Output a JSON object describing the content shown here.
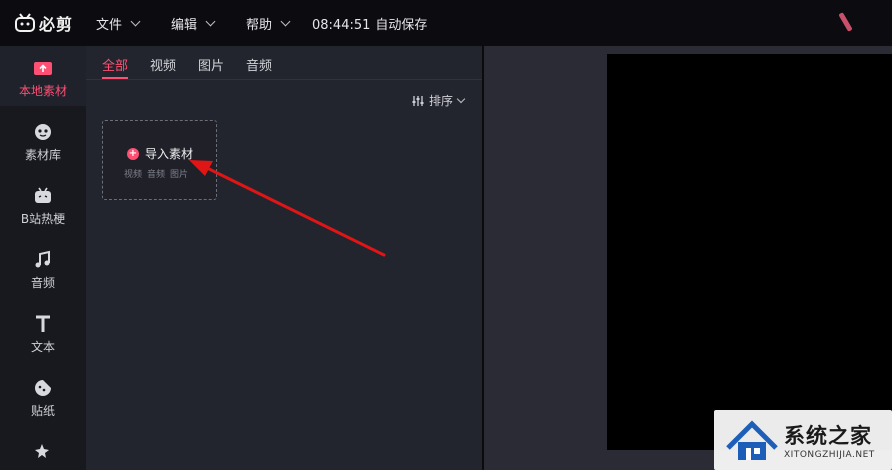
{
  "app": {
    "logo_text": "必剪",
    "menus": [
      {
        "label": "文件"
      },
      {
        "label": "编辑"
      },
      {
        "label": "帮助"
      }
    ],
    "autosave_time": "08:44:51",
    "autosave_label": "自动保存"
  },
  "sidebar": {
    "items": [
      {
        "label": "本地素材",
        "icon": "upload-folder-icon",
        "active": true
      },
      {
        "label": "素材库",
        "icon": "sticker-face-icon"
      },
      {
        "label": "B站热梗",
        "icon": "bilibili-tv-icon"
      },
      {
        "label": "音频",
        "icon": "music-note-icon"
      },
      {
        "label": "文本",
        "icon": "text-t-icon"
      },
      {
        "label": "贴纸",
        "icon": "sticker-icon"
      }
    ]
  },
  "media": {
    "tabs": [
      {
        "label": "全部",
        "active": true
      },
      {
        "label": "视频"
      },
      {
        "label": "图片"
      },
      {
        "label": "音频"
      }
    ],
    "sort_label": "排序",
    "import": {
      "title": "导入素材",
      "types": [
        "视频",
        "音频",
        "图片"
      ]
    }
  },
  "watermark": {
    "title": "系统之家",
    "subtitle": "XITONGZHIJIA.NET"
  },
  "colors": {
    "accent": "#ff4f73",
    "annotation": "#e01515"
  }
}
